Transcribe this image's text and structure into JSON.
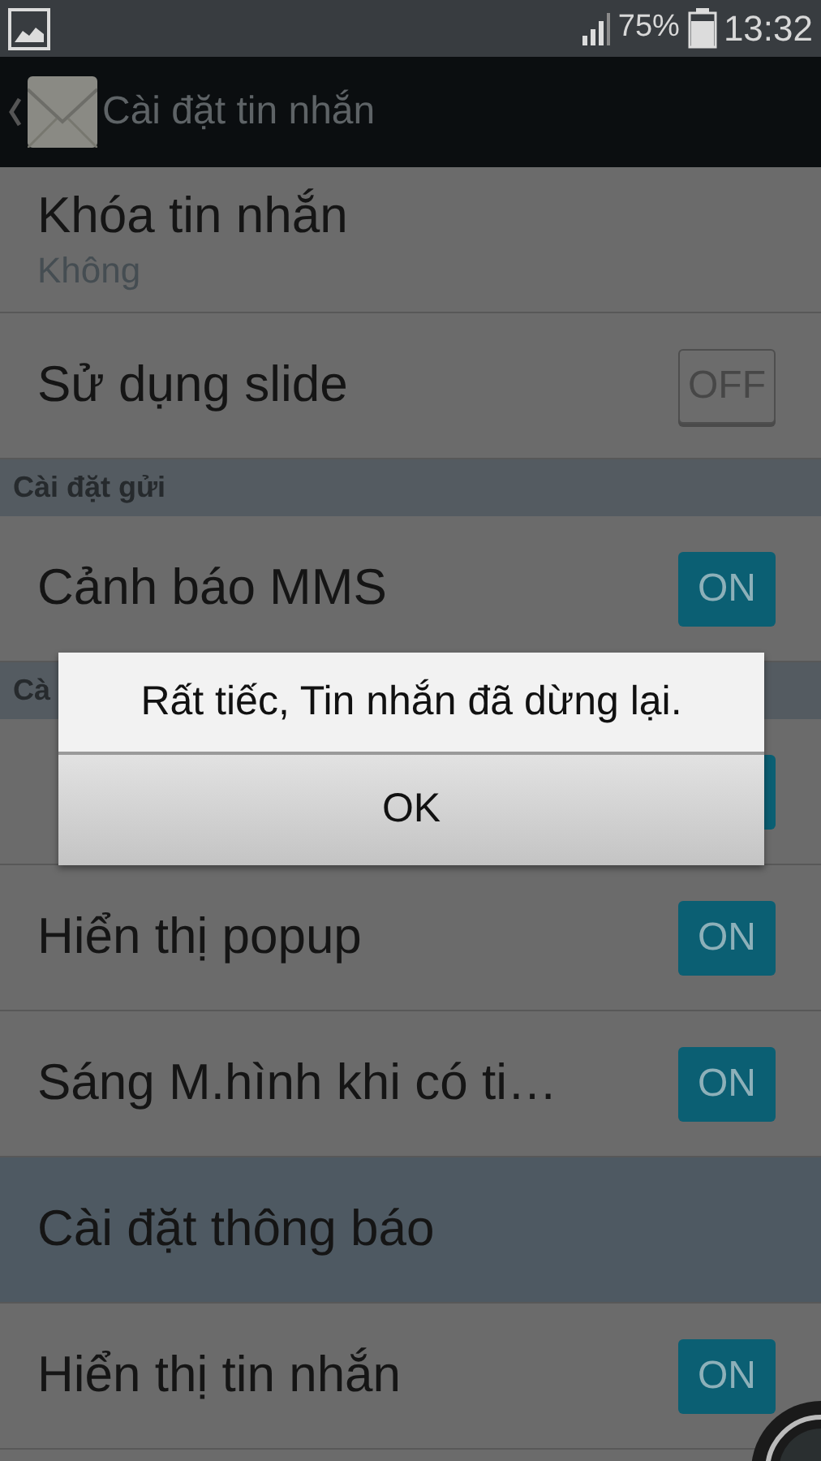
{
  "status_bar": {
    "battery": "75%",
    "time": "13:32"
  },
  "header": {
    "title": "Cài đặt tin nhắn"
  },
  "items": [
    {
      "kind": "detail",
      "title": "Khóa tin nhắn",
      "summary": "Không"
    },
    {
      "kind": "toggle",
      "title": "Sử dụng slide",
      "on": false,
      "switch_label": "OFF"
    },
    {
      "kind": "section",
      "title": "Cài đặt gửi"
    },
    {
      "kind": "toggle",
      "title": "Cảnh báo MMS",
      "on": true,
      "switch_label": "ON"
    },
    {
      "kind": "section",
      "title": "Cà"
    },
    {
      "kind": "toggle",
      "on": true
    },
    {
      "kind": "toggle",
      "title": "Hiển thị popup",
      "on": true,
      "switch_label": "ON"
    },
    {
      "kind": "toggle",
      "title": "Sáng M.hình khi có ti…",
      "on": true,
      "switch_label": "ON"
    },
    {
      "kind": "category",
      "title": "Cài đặt thông báo"
    },
    {
      "kind": "toggle",
      "title": "Hiển thị tin nhắn",
      "on": true,
      "switch_label": "ON"
    }
  ],
  "dialog": {
    "message": "Rất tiếc, Tin nhắn đã dừng lại.",
    "button": "OK"
  }
}
